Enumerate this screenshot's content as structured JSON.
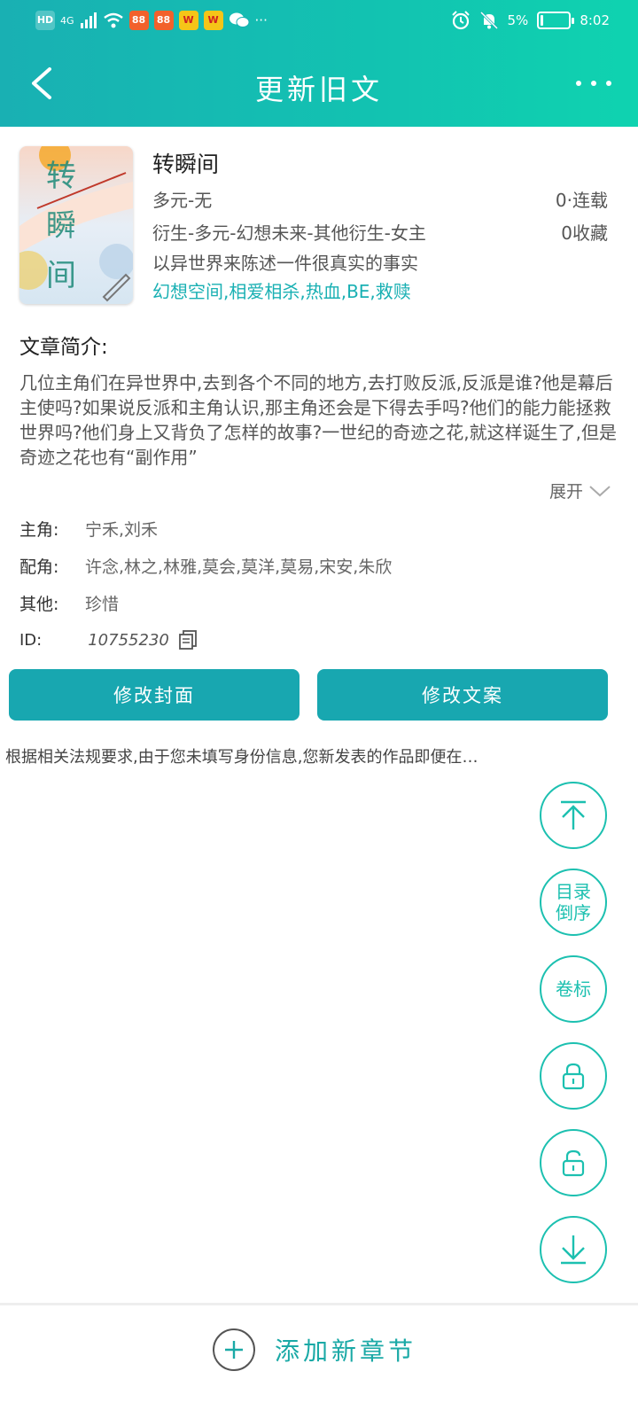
{
  "status_bar": {
    "network": "4G",
    "hd": "HD",
    "battery": "5%",
    "time": "8:02",
    "battery_level": 0.05
  },
  "header": {
    "title": "更新旧文"
  },
  "book": {
    "title": "转瞬间",
    "category": "多元-无",
    "genre": "衍生-多元-幻想未来-其他衍生-女主",
    "tagline": "以异世界来陈述一件很真实的事实",
    "tags": "幻想空间,相爱相杀,热血,BE,救赎",
    "status": "0·连载",
    "favorites": "0收藏",
    "cover_text": "转瞬间"
  },
  "intro": {
    "heading": "文章简介:",
    "text": "几位主角们在异世界中,去到各个不同的地方,去打败反派,反派是谁?他是幕后主使吗?如果说反派和主角认识,那主角还会是下得去手吗?他们的能力能拯救世界吗?他们身上又背负了怎样的故事?一世纪的奇迹之花,就这样诞生了,但是奇迹之花也有“副作用”",
    "expand_label": "展开"
  },
  "meta": {
    "protagonist_label": "主角:",
    "protagonist": "宁禾,刘禾",
    "supporting_label": "配角:",
    "supporting": "许念,林之,林雅,莫会,莫洋,莫易,宋安,朱欣",
    "other_label": "其他:",
    "other": "珍惜",
    "id_label": "ID:",
    "id_value": "10755230"
  },
  "buttons": {
    "edit_cover": "修改封面",
    "edit_copy": "修改文案"
  },
  "notice": "根据相关法规要求,由于您未填写身份信息,您新发表的作品即便在…",
  "fabs": {
    "catalog_reverse": "目录\n倒序",
    "volume": "卷标"
  },
  "bottom": {
    "add_chapter": "添加新章节"
  },
  "colors": {
    "accent": "#19b0b3",
    "button": "#18a7b0",
    "fab_border": "#1cc0b0"
  }
}
